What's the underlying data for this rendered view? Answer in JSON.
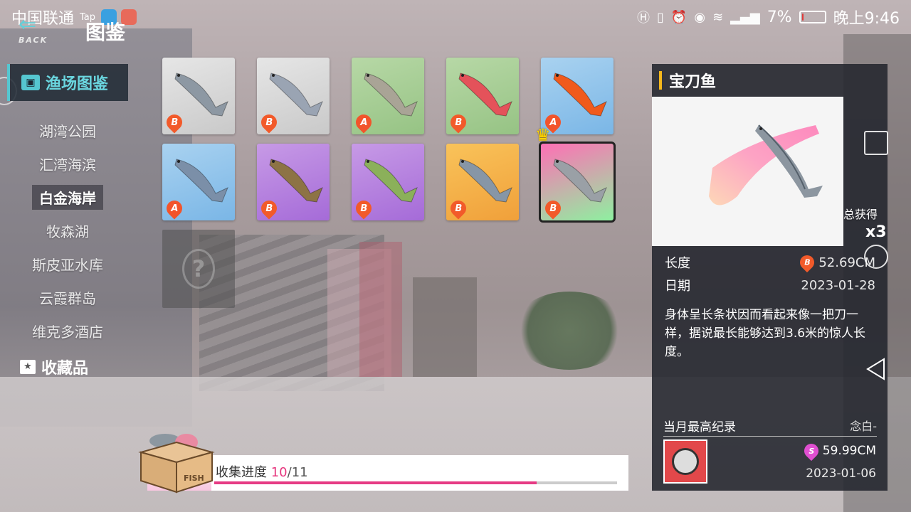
{
  "status_bar": {
    "carrier": "中国联通",
    "tag": "Tap",
    "battery": "7%",
    "time": "晚上9:46",
    "battery_level": 0.07
  },
  "header": {
    "back_label": "BACK",
    "title": "图鉴"
  },
  "sidebar": {
    "active": "渔场图鉴",
    "items": [
      {
        "label": "湖湾公园"
      },
      {
        "label": "汇湾海滨"
      },
      {
        "label": "白金海岸"
      },
      {
        "label": "牧森湖"
      },
      {
        "label": "斯皮亚水库"
      },
      {
        "label": "云霞群岛"
      },
      {
        "label": "维克多酒店"
      }
    ],
    "selected_index": 2,
    "collection": "收藏品"
  },
  "fish": [
    {
      "grade": "B",
      "bg": [
        "#e6e6e6",
        "#c9c9c9"
      ],
      "color": "#8d98a3"
    },
    {
      "grade": "B",
      "bg": [
        "#e6e6e6",
        "#c9c9c9"
      ],
      "color": "#9aa4b3"
    },
    {
      "grade": "A",
      "bg": [
        "#b7d8a6",
        "#96c384"
      ],
      "color": "#a9a496"
    },
    {
      "grade": "B",
      "bg": [
        "#b7d8a6",
        "#96c384"
      ],
      "color": "#e4525a"
    },
    {
      "grade": "A",
      "bg": [
        "#a9d2f0",
        "#7ab6e6"
      ],
      "color": "#f05a1c"
    },
    {
      "grade": "A",
      "bg": [
        "#a9d2f0",
        "#7ab6e6"
      ],
      "color": "#7b8fa8"
    },
    {
      "grade": "B",
      "bg": [
        "#c79ae6",
        "#a56bd8"
      ],
      "color": "#8d7345"
    },
    {
      "grade": "B",
      "bg": [
        "#c79ae6",
        "#a56bd8"
      ],
      "color": "#8bb05a"
    },
    {
      "grade": "B",
      "bg": [
        "#f9c35a",
        "#f0a03a"
      ],
      "color": "#8796a6"
    },
    {
      "grade": "B",
      "bg": [
        "#ff6fb5",
        "#8ef0a0"
      ],
      "color": "#9aa0a6",
      "crown": true,
      "selected": true
    }
  ],
  "detail": {
    "name": "宝刀鱼",
    "length_label": "长度",
    "length_value": "52.69CM",
    "length_grade": "B",
    "date_label": "日期",
    "date_value": "2023-01-28",
    "description": "身体呈长条状因而看起来像一把刀一样，据说最长能够达到3.6米的惊人长度。",
    "total_label": "总获得",
    "total_value": "x3",
    "record_title": "当月最高纪录",
    "record_holder": "念白-",
    "record_value": "59.99CM",
    "record_grade": "S",
    "record_date": "2023-01-06"
  },
  "progress": {
    "label": "收集进度",
    "count": "10",
    "total": "/11",
    "fraction": 0.8,
    "box_label": "FISH"
  }
}
